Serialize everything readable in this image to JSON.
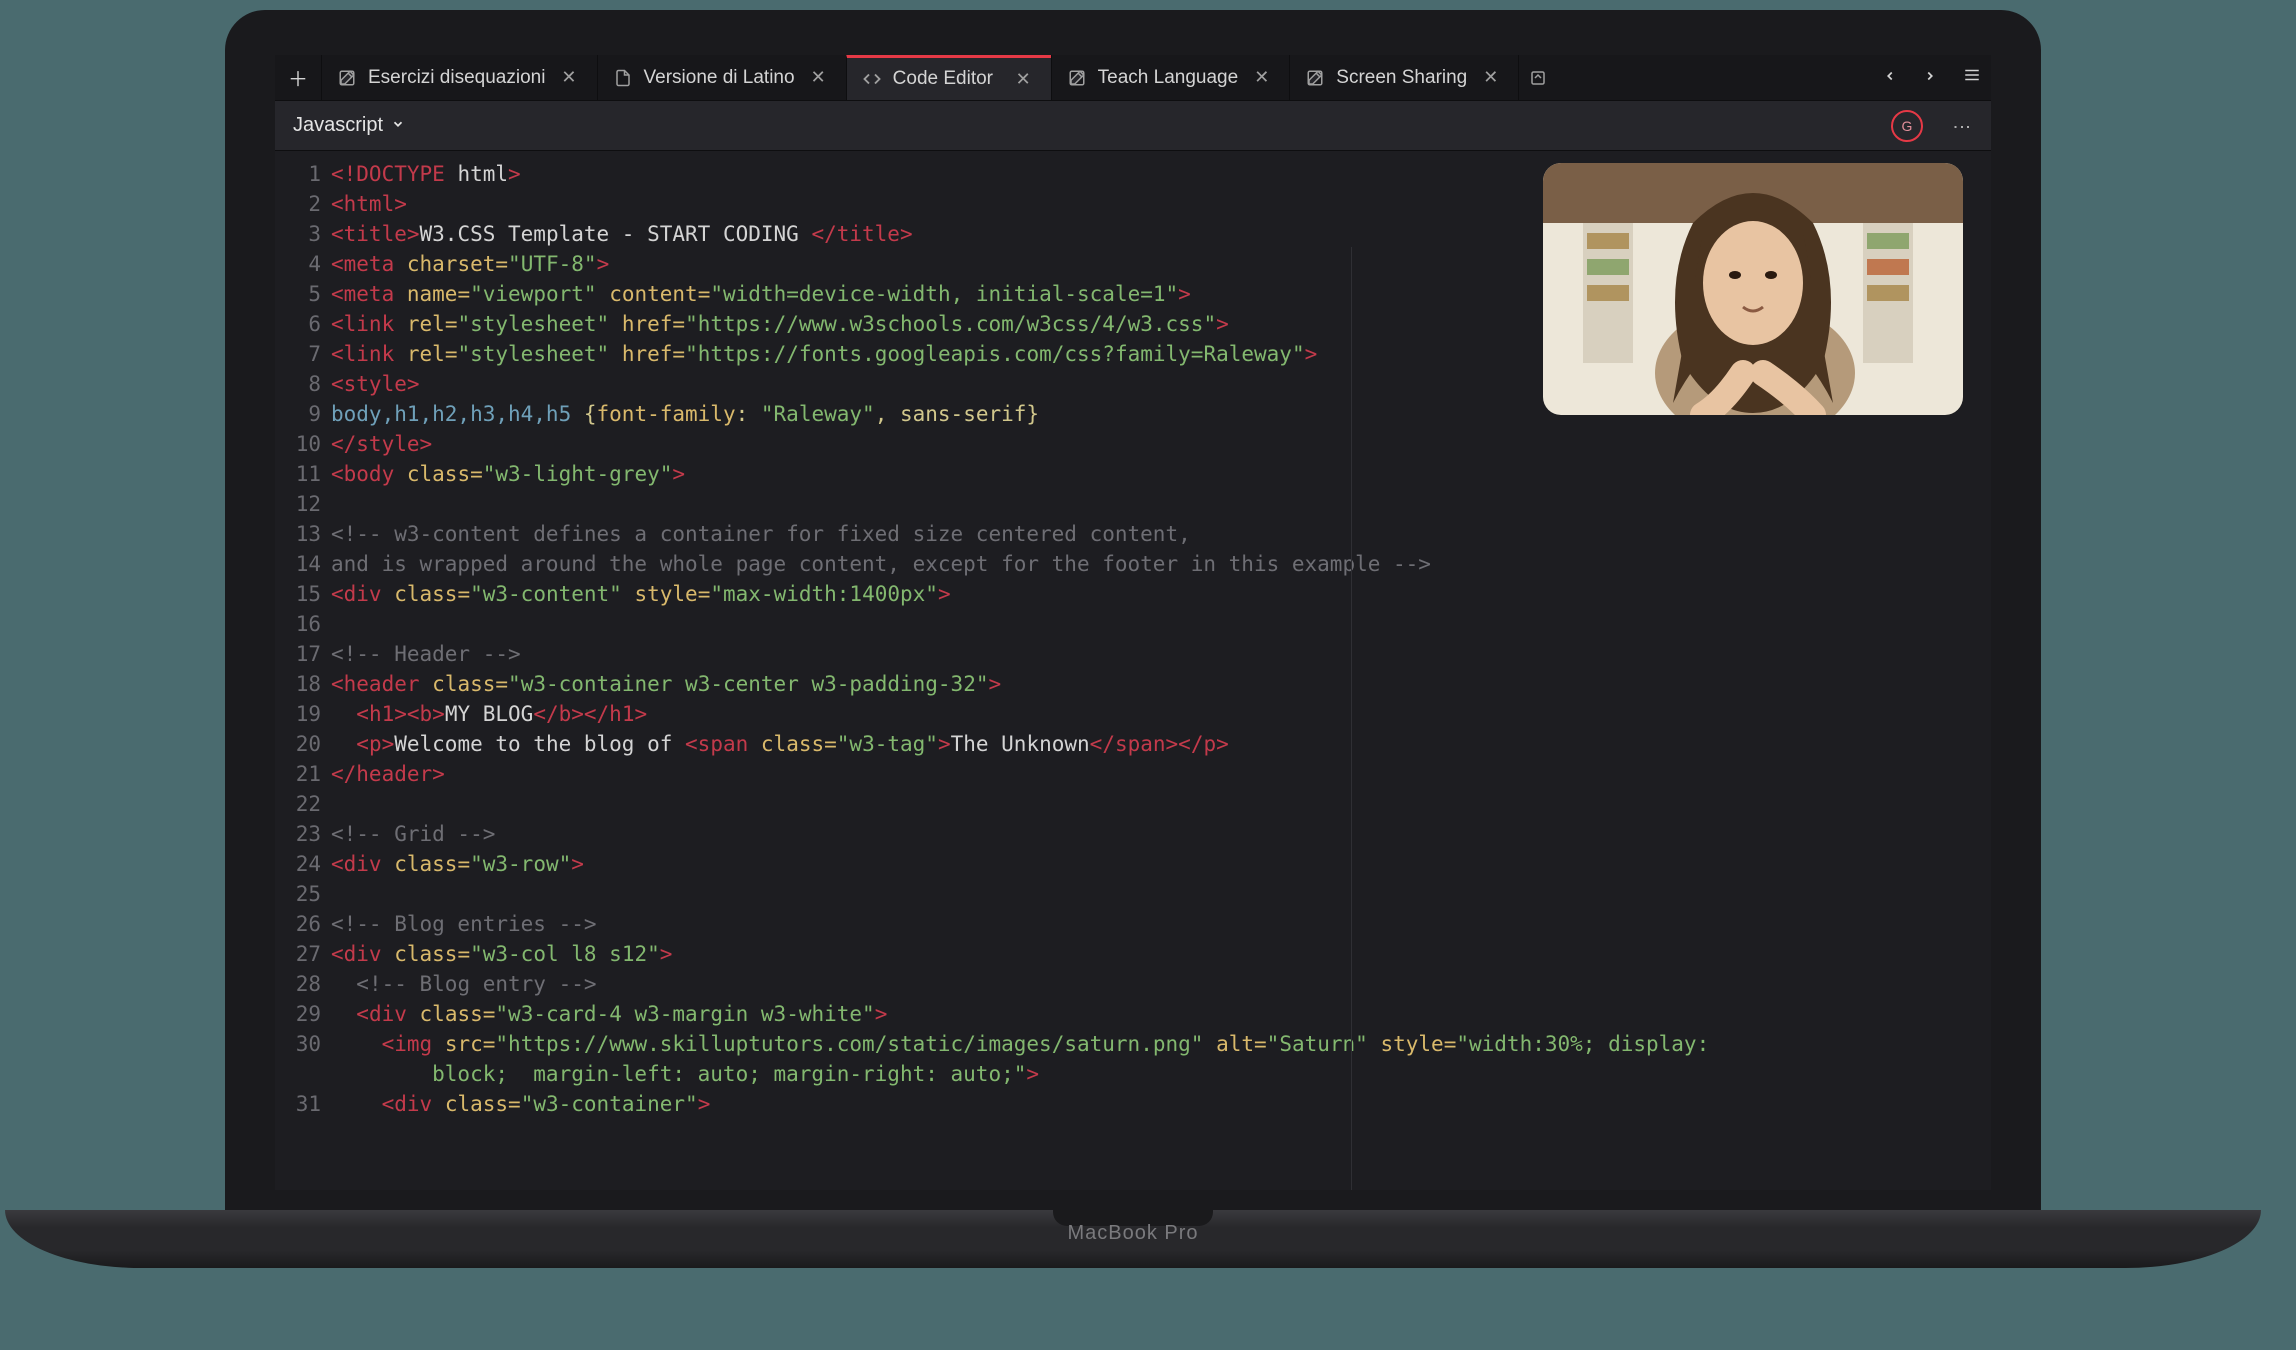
{
  "laptop_label": "MacBook Pro",
  "tabs": [
    {
      "icon": "pencil-square",
      "label": "Esercizi disequazioni",
      "active": false
    },
    {
      "icon": "file",
      "label": "Versione di Latino",
      "active": false
    },
    {
      "icon": "code",
      "label": "Code Editor",
      "active": true
    },
    {
      "icon": "pencil-square",
      "label": "Teach Language",
      "active": false
    },
    {
      "icon": "pencil-square",
      "label": "Screen Sharing",
      "active": false
    }
  ],
  "language_selector": "Javascript",
  "avatar_initial": "G",
  "code_lines": [
    {
      "n": 1,
      "segments": [
        {
          "t": "<!DOCTYPE",
          "c": "c-tag"
        },
        {
          "t": " ",
          "c": "c-text"
        },
        {
          "t": "html",
          "c": "c-text"
        },
        {
          "t": ">",
          "c": "c-tag"
        }
      ]
    },
    {
      "n": 2,
      "segments": [
        {
          "t": "<html>",
          "c": "c-tag"
        }
      ]
    },
    {
      "n": 3,
      "segments": [
        {
          "t": "<title>",
          "c": "c-tag"
        },
        {
          "t": "W3.CSS Template - START CODING ",
          "c": "c-text"
        },
        {
          "t": "</title>",
          "c": "c-tag"
        }
      ]
    },
    {
      "n": 4,
      "segments": [
        {
          "t": "<meta",
          "c": "c-tag"
        },
        {
          "t": " ",
          "c": "c-text"
        },
        {
          "t": "charset",
          "c": "c-attr"
        },
        {
          "t": "=",
          "c": "c-attr"
        },
        {
          "t": "\"UTF-8\"",
          "c": "c-str"
        },
        {
          "t": ">",
          "c": "c-tag"
        }
      ]
    },
    {
      "n": 5,
      "segments": [
        {
          "t": "<meta",
          "c": "c-tag"
        },
        {
          "t": " ",
          "c": "c-text"
        },
        {
          "t": "name",
          "c": "c-attr"
        },
        {
          "t": "=",
          "c": "c-attr"
        },
        {
          "t": "\"viewport\"",
          "c": "c-str"
        },
        {
          "t": " ",
          "c": "c-text"
        },
        {
          "t": "content",
          "c": "c-attr"
        },
        {
          "t": "=",
          "c": "c-attr"
        },
        {
          "t": "\"width=device-width, initial-scale=1\"",
          "c": "c-str"
        },
        {
          "t": ">",
          "c": "c-tag"
        }
      ]
    },
    {
      "n": 6,
      "segments": [
        {
          "t": "<link",
          "c": "c-tag"
        },
        {
          "t": " ",
          "c": "c-text"
        },
        {
          "t": "rel",
          "c": "c-attr"
        },
        {
          "t": "=",
          "c": "c-attr"
        },
        {
          "t": "\"stylesheet\"",
          "c": "c-str"
        },
        {
          "t": " ",
          "c": "c-text"
        },
        {
          "t": "href",
          "c": "c-attr"
        },
        {
          "t": "=",
          "c": "c-attr"
        },
        {
          "t": "\"https://www.w3schools.com/w3css/4/w3.css\"",
          "c": "c-str"
        },
        {
          "t": ">",
          "c": "c-tag"
        }
      ]
    },
    {
      "n": 7,
      "segments": [
        {
          "t": "<link",
          "c": "c-tag"
        },
        {
          "t": " ",
          "c": "c-text"
        },
        {
          "t": "rel",
          "c": "c-attr"
        },
        {
          "t": "=",
          "c": "c-attr"
        },
        {
          "t": "\"stylesheet\"",
          "c": "c-str"
        },
        {
          "t": " ",
          "c": "c-text"
        },
        {
          "t": "href",
          "c": "c-attr"
        },
        {
          "t": "=",
          "c": "c-attr"
        },
        {
          "t": "\"https://fonts.googleapis.com/css?family=Raleway\"",
          "c": "c-str"
        },
        {
          "t": ">",
          "c": "c-tag"
        }
      ]
    },
    {
      "n": 8,
      "segments": [
        {
          "t": "<style>",
          "c": "c-tag"
        }
      ]
    },
    {
      "n": 9,
      "segments": [
        {
          "t": "body,h1,h2,h3,h4,h5",
          "c": "c-sel"
        },
        {
          "t": " {",
          "c": "c-punc"
        },
        {
          "t": "font-family",
          "c": "c-attr"
        },
        {
          "t": ": ",
          "c": "c-punc"
        },
        {
          "t": "\"Raleway\"",
          "c": "c-str"
        },
        {
          "t": ", sans-serif}",
          "c": "c-punc"
        }
      ]
    },
    {
      "n": 10,
      "segments": [
        {
          "t": "</style>",
          "c": "c-tag"
        }
      ]
    },
    {
      "n": 11,
      "segments": [
        {
          "t": "<body",
          "c": "c-tag"
        },
        {
          "t": " ",
          "c": "c-text"
        },
        {
          "t": "class",
          "c": "c-attr"
        },
        {
          "t": "=",
          "c": "c-attr"
        },
        {
          "t": "\"w3-light-grey\"",
          "c": "c-str"
        },
        {
          "t": ">",
          "c": "c-tag"
        }
      ]
    },
    {
      "n": 12,
      "segments": []
    },
    {
      "n": 13,
      "segments": [
        {
          "t": "<!-- w3-content defines a container for fixed size centered content,",
          "c": "c-com"
        }
      ]
    },
    {
      "n": 14,
      "segments": [
        {
          "t": "and is wrapped around the whole page content, except for the footer in this example -->",
          "c": "c-com"
        }
      ]
    },
    {
      "n": 15,
      "segments": [
        {
          "t": "<div",
          "c": "c-tag"
        },
        {
          "t": " ",
          "c": "c-text"
        },
        {
          "t": "class",
          "c": "c-attr"
        },
        {
          "t": "=",
          "c": "c-attr"
        },
        {
          "t": "\"w3-content\"",
          "c": "c-str"
        },
        {
          "t": " ",
          "c": "c-text"
        },
        {
          "t": "style",
          "c": "c-attr"
        },
        {
          "t": "=",
          "c": "c-attr"
        },
        {
          "t": "\"max-width:1400px\"",
          "c": "c-str"
        },
        {
          "t": ">",
          "c": "c-tag"
        }
      ]
    },
    {
      "n": 16,
      "segments": []
    },
    {
      "n": 17,
      "segments": [
        {
          "t": "<!-- Header -->",
          "c": "c-com"
        }
      ]
    },
    {
      "n": 18,
      "segments": [
        {
          "t": "<header",
          "c": "c-tag"
        },
        {
          "t": " ",
          "c": "c-text"
        },
        {
          "t": "class",
          "c": "c-attr"
        },
        {
          "t": "=",
          "c": "c-attr"
        },
        {
          "t": "\"w3-container w3-center w3-padding-32\"",
          "c": "c-str"
        },
        {
          "t": ">",
          "c": "c-tag"
        }
      ]
    },
    {
      "n": 19,
      "segments": [
        {
          "t": "  ",
          "c": "c-text"
        },
        {
          "t": "<h1><b>",
          "c": "c-tag"
        },
        {
          "t": "MY BLOG",
          "c": "c-text"
        },
        {
          "t": "</b></h1>",
          "c": "c-tag"
        }
      ]
    },
    {
      "n": 20,
      "segments": [
        {
          "t": "  ",
          "c": "c-text"
        },
        {
          "t": "<p>",
          "c": "c-tag"
        },
        {
          "t": "Welcome to the blog of ",
          "c": "c-text"
        },
        {
          "t": "<span",
          "c": "c-tag"
        },
        {
          "t": " ",
          "c": "c-text"
        },
        {
          "t": "class",
          "c": "c-attr"
        },
        {
          "t": "=",
          "c": "c-attr"
        },
        {
          "t": "\"w3-tag\"",
          "c": "c-str"
        },
        {
          "t": ">",
          "c": "c-tag"
        },
        {
          "t": "The Unknown",
          "c": "c-text"
        },
        {
          "t": "</span></p>",
          "c": "c-tag"
        }
      ]
    },
    {
      "n": 21,
      "segments": [
        {
          "t": "</header>",
          "c": "c-tag"
        }
      ]
    },
    {
      "n": 22,
      "segments": []
    },
    {
      "n": 23,
      "segments": [
        {
          "t": "<!-- Grid -->",
          "c": "c-com"
        }
      ]
    },
    {
      "n": 24,
      "segments": [
        {
          "t": "<div",
          "c": "c-tag"
        },
        {
          "t": " ",
          "c": "c-text"
        },
        {
          "t": "class",
          "c": "c-attr"
        },
        {
          "t": "=",
          "c": "c-attr"
        },
        {
          "t": "\"w3-row\"",
          "c": "c-str"
        },
        {
          "t": ">",
          "c": "c-tag"
        }
      ]
    },
    {
      "n": 25,
      "segments": []
    },
    {
      "n": 26,
      "segments": [
        {
          "t": "<!-- Blog entries -->",
          "c": "c-com"
        }
      ]
    },
    {
      "n": 27,
      "segments": [
        {
          "t": "<div",
          "c": "c-tag"
        },
        {
          "t": " ",
          "c": "c-text"
        },
        {
          "t": "class",
          "c": "c-attr"
        },
        {
          "t": "=",
          "c": "c-attr"
        },
        {
          "t": "\"w3-col l8 s12\"",
          "c": "c-str"
        },
        {
          "t": ">",
          "c": "c-tag"
        }
      ]
    },
    {
      "n": 28,
      "segments": [
        {
          "t": "  ",
          "c": "c-text"
        },
        {
          "t": "<!-- Blog entry -->",
          "c": "c-com"
        }
      ]
    },
    {
      "n": 29,
      "segments": [
        {
          "t": "  ",
          "c": "c-text"
        },
        {
          "t": "<div",
          "c": "c-tag"
        },
        {
          "t": " ",
          "c": "c-text"
        },
        {
          "t": "class",
          "c": "c-attr"
        },
        {
          "t": "=",
          "c": "c-attr"
        },
        {
          "t": "\"w3-card-4 w3-margin w3-white\"",
          "c": "c-str"
        },
        {
          "t": ">",
          "c": "c-tag"
        }
      ]
    },
    {
      "n": 30,
      "segments": [
        {
          "t": "    ",
          "c": "c-text"
        },
        {
          "t": "<img",
          "c": "c-tag"
        },
        {
          "t": " ",
          "c": "c-text"
        },
        {
          "t": "src",
          "c": "c-attr"
        },
        {
          "t": "=",
          "c": "c-attr"
        },
        {
          "t": "\"https://www.skilluptutors.com/static/images/saturn.png\"",
          "c": "c-str"
        },
        {
          "t": " ",
          "c": "c-text"
        },
        {
          "t": "alt",
          "c": "c-attr"
        },
        {
          "t": "=",
          "c": "c-attr"
        },
        {
          "t": "\"Saturn\"",
          "c": "c-str"
        },
        {
          "t": " ",
          "c": "c-text"
        },
        {
          "t": "style",
          "c": "c-attr"
        },
        {
          "t": "=",
          "c": "c-attr"
        },
        {
          "t": "\"width:30%; display: ",
          "c": "c-str"
        }
      ]
    },
    {
      "n": "",
      "segments": [
        {
          "t": "        block;  margin-left: auto; margin-right: auto;\"",
          "c": "c-str"
        },
        {
          "t": ">",
          "c": "c-tag"
        }
      ]
    },
    {
      "n": 31,
      "segments": [
        {
          "t": "    ",
          "c": "c-text"
        },
        {
          "t": "<div",
          "c": "c-tag"
        },
        {
          "t": " ",
          "c": "c-text"
        },
        {
          "t": "class",
          "c": "c-attr"
        },
        {
          "t": "=",
          "c": "c-attr"
        },
        {
          "t": "\"w3-container\"",
          "c": "c-str"
        },
        {
          "t": ">",
          "c": "c-tag"
        }
      ]
    }
  ]
}
